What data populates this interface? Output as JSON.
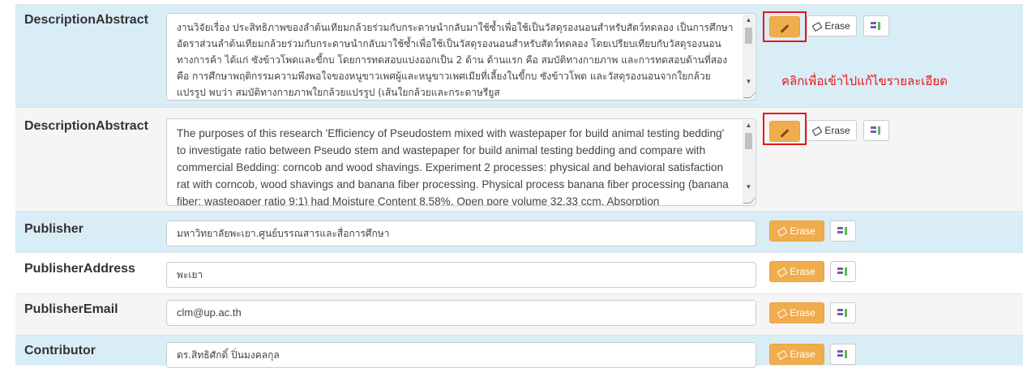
{
  "buttons": {
    "erase_label": "Erase"
  },
  "note": "คลิกเพื่อเข้าไปแก้ไขรายละเอียด",
  "fields": [
    {
      "label": "DescriptionAbstract",
      "value": "งานวิจัยเรื่อง ประสิทธิภาพของลำต้นเทียมกล้วยร่วมกับกระดาษนำกลับมาใช้ซ้ำเพื่อใช้เป็นวัสดุรองนอนสำหรับสัตว์ทดลอง เป็นการศึกษาอัตราส่วนลำต้นเทียมกล้วยร่วมกับกระดาษนำกลับมาใช้ซ้ำเพื่อใช้เป็นวัสดุรองนอนสำหรับสัตว์ทดลอง โดยเปรียบเทียบกับวัสดุรองนอนทางการค้า ได้แก่ ซังข้าวโพดและขี้กบ โดยการทดสอบแบ่งออกเป็น 2 ด้าน ด้านแรก คือ สมบัติทางกายภาพ และการทดสอบด้านที่สอง คือ การศึกษาพฤติกรรมความพึงพอใจของหนูขาวเพศผู้และหนูขาวเพศเมียที่เลี้ยงในขี้กบ ซังข้าวโพด และวัสดุรองนอนจากใยกล้วยแปรรูป พบว่า สมบัติทางกายภาพใยกล้วยแปรรูป (เส้นใยกล้วยและกระดาษรียูส"
    },
    {
      "label": "DescriptionAbstract",
      "value": "The purposes of this research 'Efficiency of Pseudostem mixed with wastepaper for build animal testing bedding' to investigate ratio between Pseudo stem and wastepaper for build animal testing bedding and compare with commercial Bedding: corncob and wood shavings. Experiment 2 processes: physical and behavioral satisfaction rat with corncob, wood shavings and banana fiber processing. Physical process banana fiber processing (banana fiber: wastepaper ratio 9:1) had Moisture Content 8.58%, Open pore volume 32.33 ccm, Absorption"
    },
    {
      "label": "Publisher",
      "value": "มหาวิทยาลัยพะเยา.ศูนย์บรรณสารและสื่อการศึกษา"
    },
    {
      "label": "PublisherAddress",
      "value": "พะเยา"
    },
    {
      "label": "PublisherEmail",
      "value": "clm@up.ac.th"
    },
    {
      "label": "Contributor",
      "value": "ดร.สิทธิศักดิ์ ปิ่นมงคลกุล"
    }
  ],
  "icons": [
    "pencil-icon",
    "eraser-icon",
    "split-icon",
    "scroll-up-icon",
    "scroll-down-icon"
  ],
  "colors": {
    "row_blue": "#d9edf7",
    "row_grey": "#f5f5f5",
    "btn_orange": "#f0ad4e",
    "annotation_red": "#e8141b"
  }
}
